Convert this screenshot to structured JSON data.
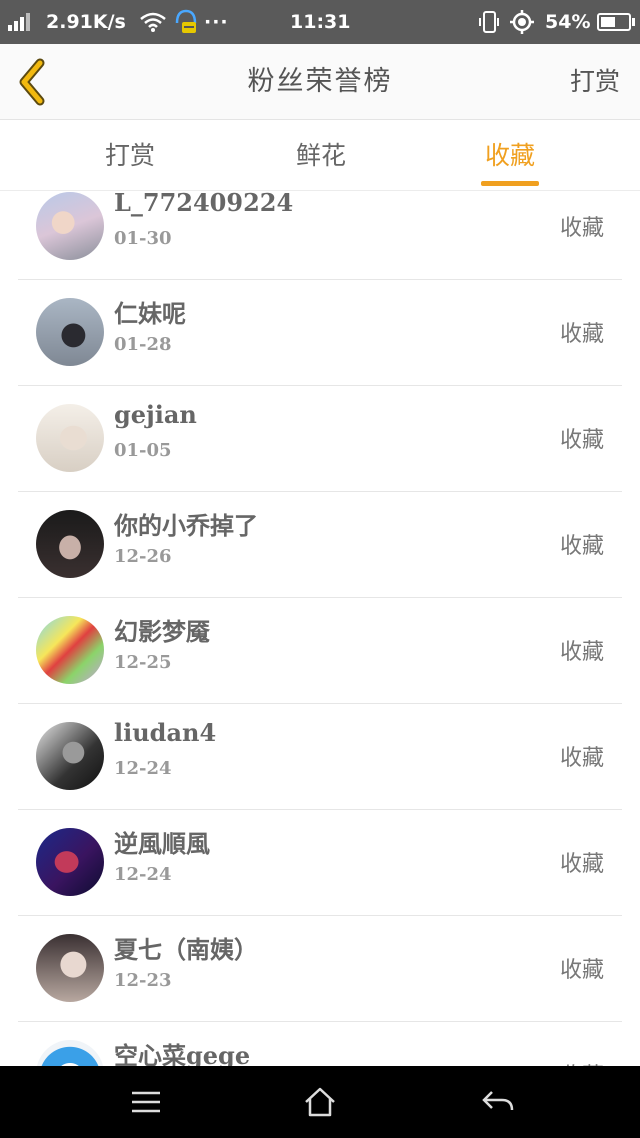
{
  "status_bar": {
    "net_speed": "2.91K/s",
    "dots": "···",
    "time": "11:31",
    "battery_pct": "54%",
    "battery_level": 0.54,
    "icons": [
      "signal-icon",
      "wifi-icon",
      "headset-icon",
      "phone-vibrate-icon",
      "location-icon",
      "battery-icon"
    ]
  },
  "header": {
    "title": "粉丝荣誉榜",
    "right_action": "打赏",
    "back_icon": "chevron-left-icon"
  },
  "tabs": [
    {
      "label": "打赏",
      "active": false
    },
    {
      "label": "鲜花",
      "active": false
    },
    {
      "label": "收藏",
      "active": true
    }
  ],
  "colors": {
    "accent": "#f0a020",
    "status_bar": "#5a5a5a",
    "nav_bar": "#000000"
  },
  "list": {
    "items": [
      {
        "name": "L_772409224",
        "date": "01-30",
        "action": "收藏"
      },
      {
        "name": "仁妹呢",
        "date": "01-28",
        "action": "收藏"
      },
      {
        "name": "gejian",
        "date": "01-05",
        "action": "收藏"
      },
      {
        "name": "你的小乔掉了",
        "date": "12-26",
        "action": "收藏"
      },
      {
        "name": "幻影梦魇",
        "date": "12-25",
        "action": "收藏"
      },
      {
        "name": "liudan4",
        "date": "12-24",
        "action": "收藏"
      },
      {
        "name": "逆風順風",
        "date": "12-24",
        "action": "收藏"
      },
      {
        "name": "夏七（南姨）",
        "date": "12-23",
        "action": "收藏"
      },
      {
        "name": "空心菜gege",
        "date": "",
        "action": "收藏"
      }
    ]
  },
  "nav_bar": {
    "icons": [
      "menu-icon",
      "home-icon",
      "back-arrow-icon"
    ]
  }
}
